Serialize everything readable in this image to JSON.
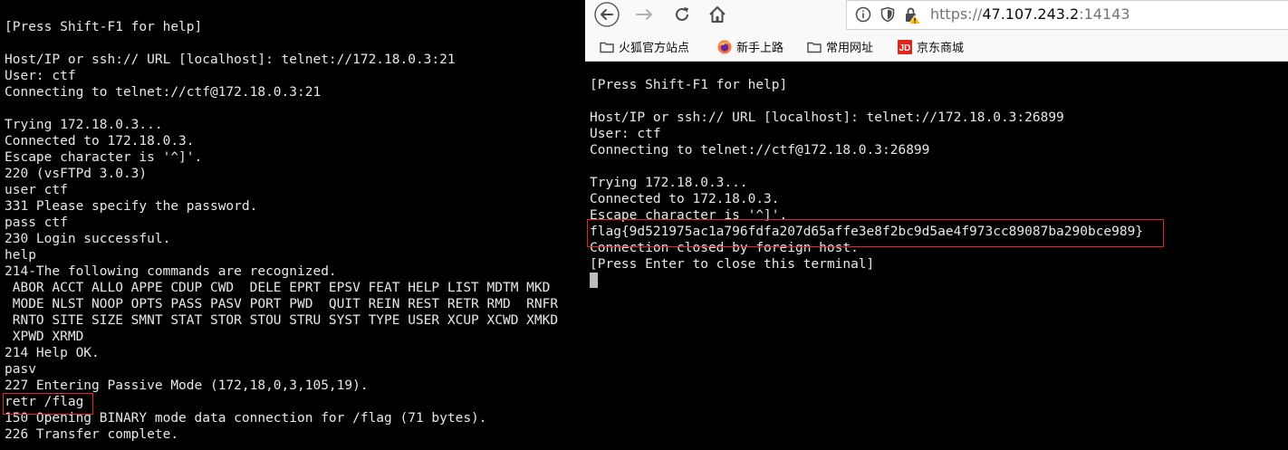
{
  "left_terminal": {
    "lines": [
      "[Press Shift-F1 for help]",
      "",
      "Host/IP or ssh:// URL [localhost]: telnet://172.18.0.3:21",
      "User: ctf",
      "Connecting to telnet://ctf@172.18.0.3:21",
      "",
      "Trying 172.18.0.3...",
      "Connected to 172.18.0.3.",
      "Escape character is '^]'.",
      "220 (vsFTPd 3.0.3)",
      "user ctf",
      "331 Please specify the password.",
      "pass ctf",
      "230 Login successful.",
      "help",
      "214-The following commands are recognized.",
      " ABOR ACCT ALLO APPE CDUP CWD  DELE EPRT EPSV FEAT HELP LIST MDTM MKD",
      " MODE NLST NOOP OPTS PASS PASV PORT PWD  QUIT REIN REST RETR RMD  RNFR",
      " RNTO SITE SIZE SMNT STAT STOR STOU STRU SYST TYPE USER XCUP XCWD XMKD",
      " XPWD XRMD",
      "214 Help OK.",
      "pasv",
      "227 Entering Passive Mode (172,18,0,3,105,19).",
      "retr /flag",
      "150 Opening BINARY mode data connection for /flag (71 bytes).",
      "226 Transfer complete."
    ]
  },
  "browser": {
    "url": {
      "scheme": "https://",
      "host": "47.107.243.2",
      "port": ":14143"
    },
    "bookmarks": [
      {
        "label": "火狐官方站点",
        "icon": "folder-icon"
      },
      {
        "label": "新手上路",
        "icon": "firefox-icon"
      },
      {
        "label": "常用网址",
        "icon": "folder-icon"
      },
      {
        "label": "京东商城",
        "icon": "jd-icon"
      }
    ]
  },
  "right_terminal": {
    "lines": [
      "[Press Shift-F1 for help]",
      "",
      "Host/IP or ssh:// URL [localhost]: telnet://172.18.0.3:26899",
      "User: ctf",
      "Connecting to telnet://ctf@172.18.0.3:26899",
      "",
      "Trying 172.18.0.3...",
      "Connected to 172.18.0.3.",
      "Escape character is '^]'.",
      "flag{9d521975ac1a796fdfa207d65affe3e8f2bc9d5ae4f973cc89087ba290bce989}",
      "Connection closed by foreign host.",
      "[Press Enter to close this terminal]"
    ]
  },
  "colors": {
    "highlight": "#e3252f",
    "terminal_bg": "#000000",
    "terminal_fg": "#e8e8e8"
  }
}
